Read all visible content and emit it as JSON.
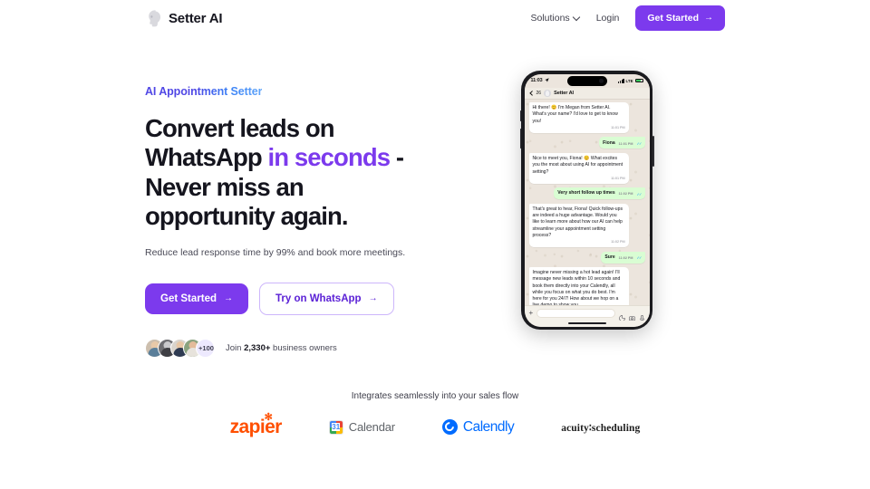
{
  "brand": {
    "name": "Setter AI",
    "logo_icon": "head-profile-icon"
  },
  "nav": {
    "solutions": "Solutions",
    "solutions_caret": "chevron-down-icon",
    "login": "Login",
    "cta": "Get Started",
    "cta_arrow": "→"
  },
  "hero": {
    "eyebrow": "AI Appointment Setter",
    "headline_part1": "Convert leads on WhatsApp ",
    "headline_accent": "in seconds",
    "headline_part2": " - Never miss an opportunity again.",
    "subhead": "Reduce lead response time by 99% and book more meetings.",
    "cta_primary": "Get Started",
    "cta_secondary": "Try on WhatsApp",
    "arrow": "→",
    "avatars_more": "+100",
    "proof_prefix": "Join ",
    "proof_count": "2,330+",
    "proof_suffix": " business owners"
  },
  "phone": {
    "status": {
      "time": "11:03",
      "location_icon": "location-arrow-icon",
      "network": "LTE",
      "signal_icon": "cellular-bars-icon",
      "battery_icon": "battery-icon"
    },
    "chat_header": {
      "back_icon": "chevron-left-icon",
      "unread": "26",
      "avatar": "contact-avatar",
      "title": "Setter AI"
    },
    "messages": [
      {
        "dir": "in",
        "text": "Hi there! 😊 I'm Megan from Setter AI. What's your name? I'd love to get to know you!",
        "time": "11:01 PM"
      },
      {
        "dir": "out",
        "text": "Fiona",
        "time": "11:01 PM"
      },
      {
        "dir": "in",
        "text": "Nice to meet you, Fiona! 😊 What excites you the most about using AI for appointment setting?",
        "time": "11:01 PM"
      },
      {
        "dir": "out",
        "text": "Very short follow up times",
        "time": "11:02 PM"
      },
      {
        "dir": "in",
        "text": "That's great to hear, Fiona! Quick follow-ups are indeed a huge advantage. Would you like to learn more about how our AI can help streamline your appointment setting process?",
        "time": "11:02 PM"
      },
      {
        "dir": "out",
        "text": "Sure",
        "time": "11:02 PM"
      },
      {
        "dir": "in",
        "text": "Imagine never missing a hot lead again! I'll message new leads within 10 seconds and book them directly into your Calendly, all while you focus on what you do best. I'm here for you 24/7! How about we hop on a live demo to show you",
        "time": ""
      }
    ],
    "composer": {
      "plus_icon": "plus-icon",
      "input_placeholder": "",
      "sticker_icon": "sticker-icon",
      "camera_icon": "camera-icon",
      "mic_icon": "microphone-icon"
    }
  },
  "integrations": {
    "title": "Integrates seamlessly into your sales flow",
    "logos": [
      {
        "name": "zapier",
        "label": "zapier",
        "icon": "zapier-logo"
      },
      {
        "name": "google-calendar",
        "label": "Calendar",
        "badge": "31",
        "icon": "google-calendar-logo"
      },
      {
        "name": "calendly",
        "label": "Calendly",
        "icon": "calendly-logo"
      },
      {
        "name": "acuity-scheduling",
        "label": "acuity∶scheduling",
        "icon": "acuity-logo"
      }
    ]
  },
  "colors": {
    "accent_purple": "#7c3aed",
    "eyebrow_blue": "#4f46e5",
    "zapier_orange": "#ff4f00",
    "calendly_blue": "#006bff",
    "whatsapp_bubble": "#d9fdd3"
  }
}
